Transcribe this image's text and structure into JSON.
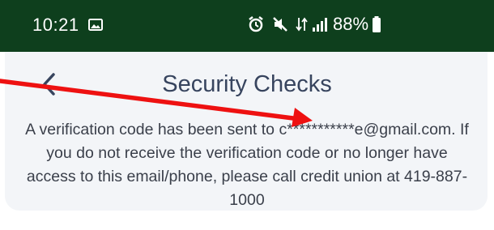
{
  "status_bar": {
    "time": "10:21",
    "battery": "88%",
    "background": "#0e3f1d",
    "icons": [
      "gallery-icon",
      "alarm-icon",
      "mute-icon",
      "data-icon",
      "signal-icon",
      "battery-icon"
    ]
  },
  "header": {
    "title": "Security Checks",
    "back_icon": "chevron-left-icon"
  },
  "message": {
    "text": "A verification code has been sent to c***********e@gmail.com. If you do not receive the verification code or no longer have access to this email/phone, please call credit union at 419-887-1000"
  },
  "annotation": {
    "type": "red-arrow",
    "color": "#ee1111"
  },
  "colors": {
    "title": "#37445e",
    "card_background": "#f3f5f8",
    "body_text": "#3a3f4a"
  }
}
